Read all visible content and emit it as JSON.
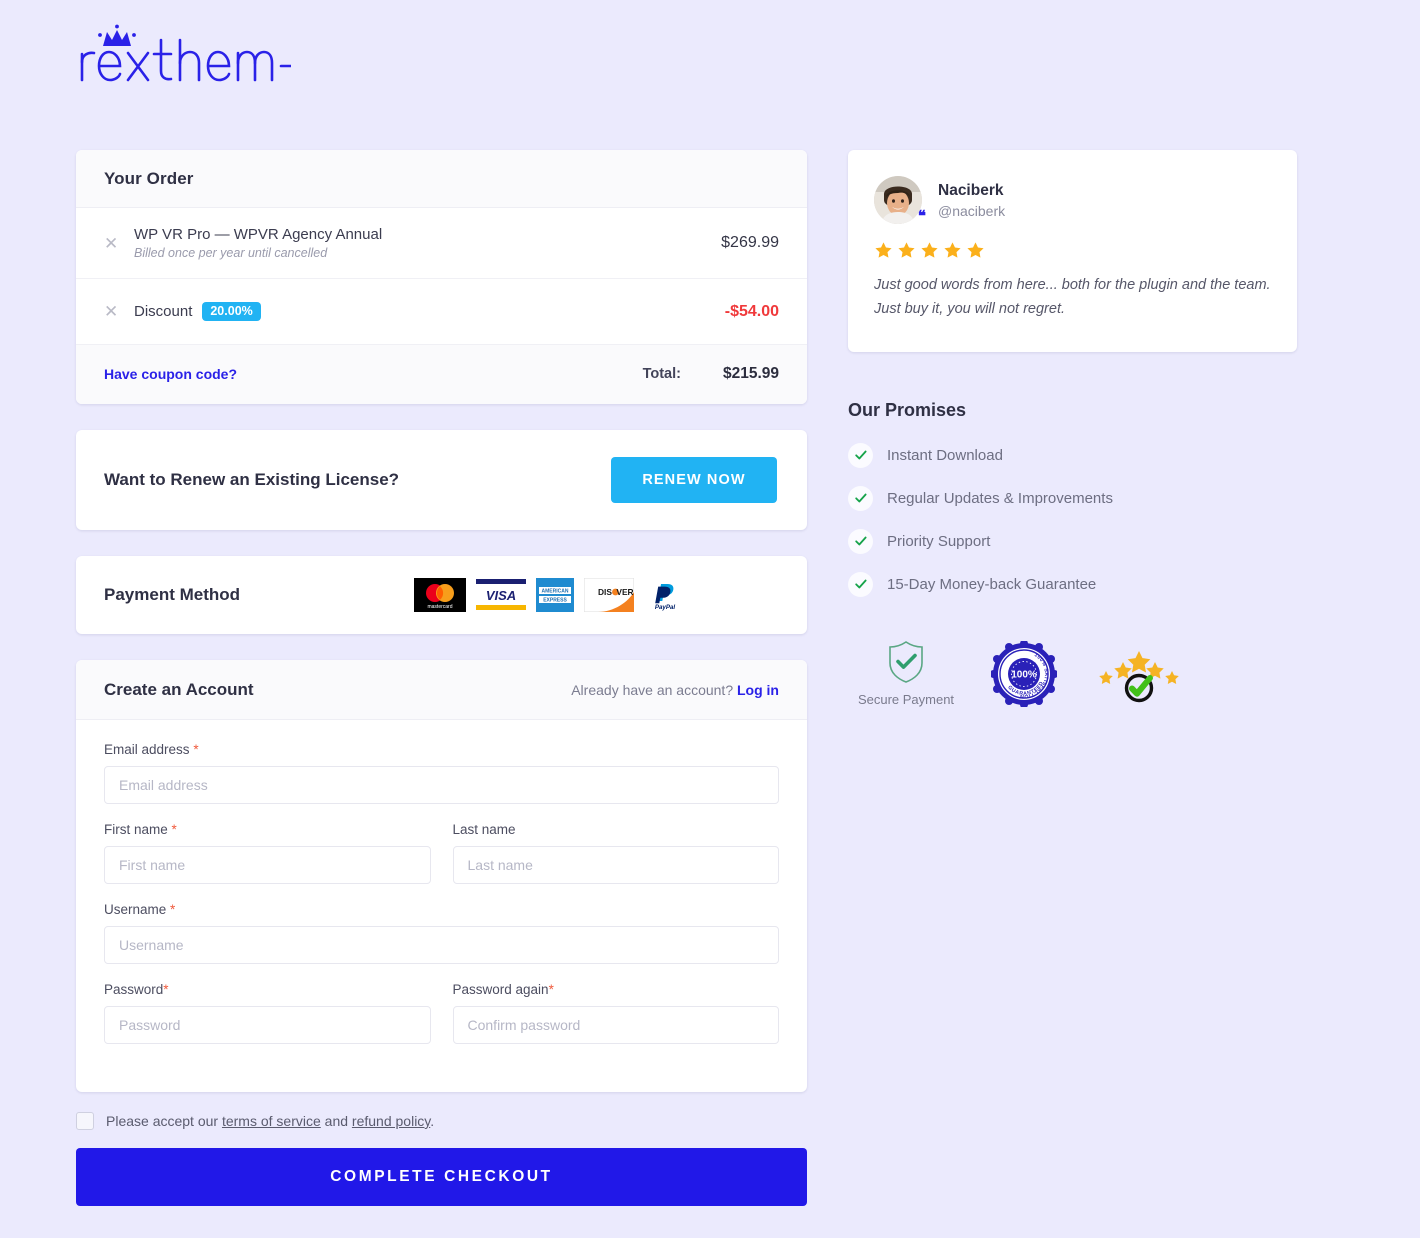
{
  "brand": {
    "name": "rextheme",
    "color": "#2a21e8"
  },
  "order": {
    "heading": "Your Order",
    "items": [
      {
        "remove_icon": "close-icon",
        "title": "WP VR Pro — WPVR Agency Annual",
        "subtitle": "Billed once per year until cancelled",
        "price": "$269.99"
      }
    ],
    "discount": {
      "remove_icon": "close-icon",
      "label": "Discount",
      "badge": "20.00%",
      "amount": "-$54.00",
      "badge_color": "#21b3f3",
      "amount_color": "#f0393b"
    },
    "coupon_link": "Have coupon code?",
    "total_label": "Total:",
    "total_value": "$215.99"
  },
  "renew": {
    "title": "Want to Renew an Existing License?",
    "button": "RENEW NOW",
    "button_color": "#21b3f3"
  },
  "payment": {
    "title": "Payment Method",
    "methods": [
      "mastercard",
      "visa",
      "american-express",
      "discover",
      "paypal"
    ]
  },
  "account": {
    "heading": "Create an Account",
    "login_prompt": "Already have an account?",
    "login_link": "Log in",
    "fields": {
      "email": {
        "label": "Email address",
        "required": true,
        "placeholder": "Email address",
        "value": ""
      },
      "first_name": {
        "label": "First name",
        "required": true,
        "placeholder": "First name",
        "value": ""
      },
      "last_name": {
        "label": "Last name",
        "required": false,
        "placeholder": "Last name",
        "value": ""
      },
      "username": {
        "label": "Username",
        "required": true,
        "placeholder": "Username",
        "value": ""
      },
      "password": {
        "label": "Password",
        "required": true,
        "placeholder": "Password",
        "value": ""
      },
      "password_again": {
        "label": "Password again",
        "required": true,
        "placeholder": "Confirm password",
        "value": ""
      }
    }
  },
  "terms": {
    "checked": false,
    "prefix": "Please accept our ",
    "link1": "terms of service",
    "middle": " and ",
    "link2": "refund policy",
    "suffix": "."
  },
  "checkout": {
    "label": "COMPLETE CHECKOUT",
    "color": "#2118e8"
  },
  "testimonial": {
    "name": "Naciberk",
    "handle": "@naciberk",
    "rating": 5,
    "star_color": "#fbb01b",
    "text": "Just good words from here... both for the plugin and the team. Just buy it, you will not regret.",
    "quote_icon": "quote-icon"
  },
  "promises": {
    "heading": "Our Promises",
    "check_color": "#16a34a",
    "items": [
      "Instant Download",
      "Regular Updates & Improvements",
      "Priority Support",
      "15-Day Money-back Guarantee"
    ]
  },
  "trust": {
    "secure": {
      "icon": "shield-check-icon",
      "caption": "Secure Payment",
      "color": "#2f9e6e"
    },
    "seal": {
      "icon": "satisfaction-seal-icon",
      "top_text": "100% SATISFACTION",
      "center_text": "100%",
      "bottom_text": "GUARANTEED",
      "color": "#2a21b8"
    },
    "rating": {
      "icon": "stars-check-icon",
      "stars": 5,
      "star_color": "#f5b324",
      "check_color": "#42c01a"
    }
  }
}
